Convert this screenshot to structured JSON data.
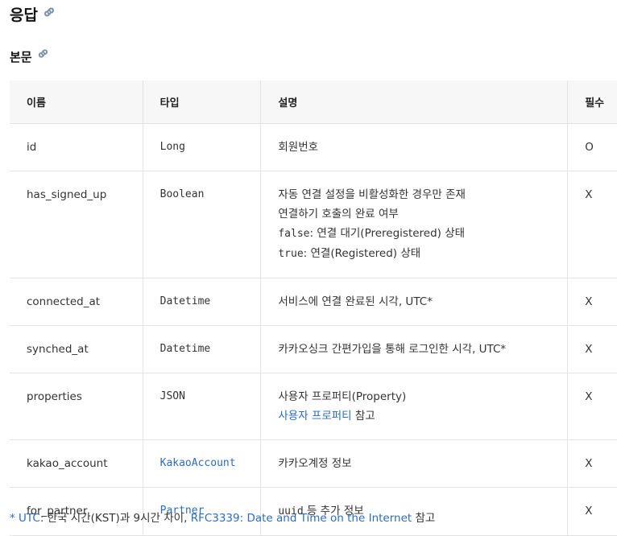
{
  "heading": "응답",
  "subheading": "본문",
  "columns": [
    "이름",
    "타입",
    "설명",
    "필수"
  ],
  "rows": [
    {
      "name": "id",
      "type": "Long",
      "desc1": "회원번호",
      "required": "O"
    },
    {
      "name": "has_signed_up",
      "type": "Boolean",
      "desc1": "자동 연결 설정을 비활성화한 경우만 존재",
      "desc2": "연결하기 호출의 완료 여부",
      "code3": "false",
      "desc3": ": 연결 대기(Preregistered) 상태",
      "code4": "true",
      "desc4": ": 연결(Registered) 상태",
      "required": "X"
    },
    {
      "name": "connected_at",
      "type": "Datetime",
      "desc1": "서비스에 연결 완료된 시각, UTC*",
      "required": "X"
    },
    {
      "name": "synched_at",
      "type": "Datetime",
      "desc1": "카카오싱크 간편가입을 통해 로그인한 시각, UTC*",
      "required": "X"
    },
    {
      "name": "properties",
      "type": "JSON",
      "desc1": "사용자 프로퍼티(Property)",
      "desc2_link": "사용자 프로퍼티",
      "desc2_rest": " 참고",
      "required": "X"
    },
    {
      "name": "kakao_account",
      "type": "KakaoAccount",
      "desc1": "카카오계정 정보",
      "required": "X"
    },
    {
      "name": "for_partner",
      "type": "Partner",
      "desc1_code": "uuid",
      "desc1": " 등 추가 정보",
      "required": "X"
    }
  ],
  "footnote": {
    "prefix": "* ",
    "utc_link": "UTC",
    "text": ": 한국 시간(KST)과 9시간 차이, ",
    "rfc_link": "RFC3339: Date and Time on the Internet",
    "suffix": " 참고"
  },
  "colors": {
    "link": "#2d6cc0",
    "header_bg": "#f7f7f7",
    "border": "#e3e3e3"
  }
}
